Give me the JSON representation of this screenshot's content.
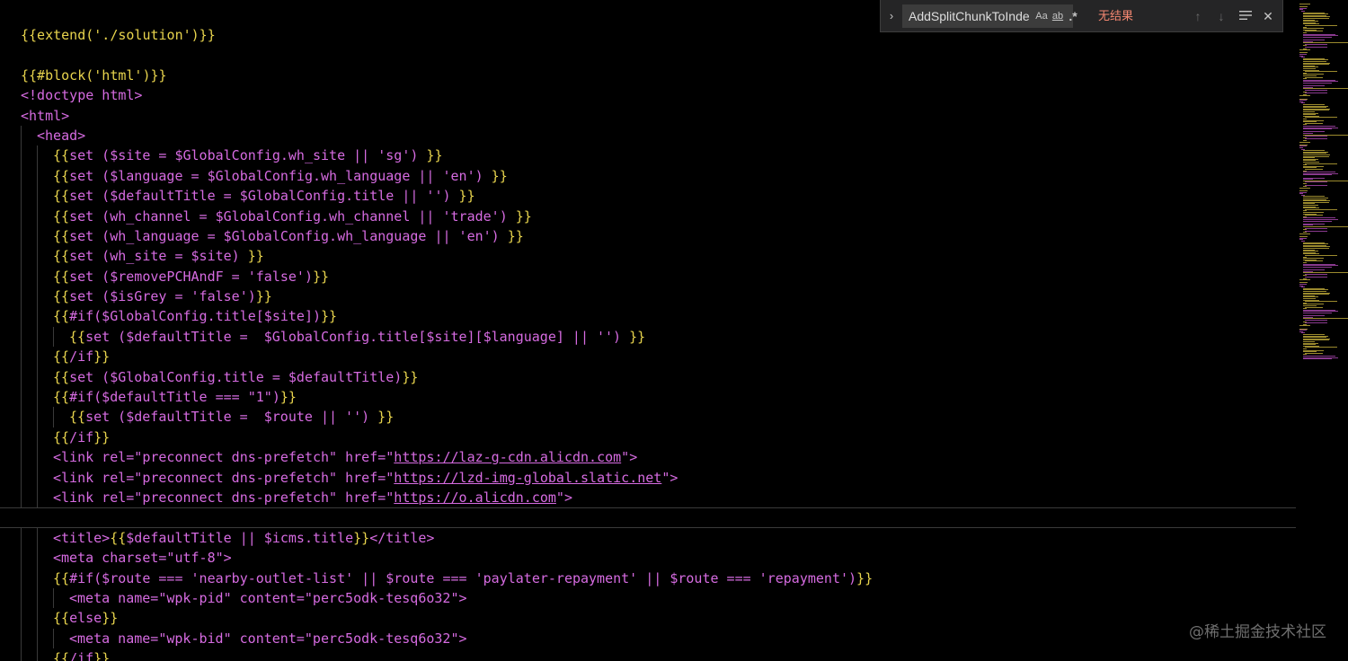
{
  "find_widget": {
    "query": "AddSplitChunkToInde",
    "match_case_label": "Aa",
    "whole_word_label": "ab",
    "regex_label": ".*",
    "result_text": "无结果",
    "toggle_icon": "chevron-right-icon",
    "prev_icon": "arrow-up-icon",
    "next_icon": "arrow-down-icon",
    "selection_icon": "find-in-selection-icon",
    "close_icon": "close-icon"
  },
  "colors": {
    "background": "#000000",
    "brace": "#e8d44d",
    "tag": "#d66be1",
    "text": "#d8d8d8",
    "no_results": "#f48771"
  },
  "watermark": "@稀土掘金技术社区",
  "code_lines": [
    {
      "indent": 0,
      "tokens": [
        [
          "b",
          "{{extend('./solution')}}"
        ]
      ]
    },
    {
      "indent": 0,
      "tokens": []
    },
    {
      "indent": 0,
      "tokens": [
        [
          "b",
          "{{#block('html')}}"
        ]
      ]
    },
    {
      "indent": 0,
      "tokens": [
        [
          "g",
          "<!doctype html>"
        ]
      ]
    },
    {
      "indent": 0,
      "tokens": [
        [
          "g",
          "<html>"
        ]
      ]
    },
    {
      "indent": 1,
      "tokens": [
        [
          "g",
          "<head>"
        ]
      ]
    },
    {
      "indent": 2,
      "tokens": [
        [
          "b",
          "{{"
        ],
        [
          "g",
          "set ($site = $GlobalConfig.wh_site || 'sg') "
        ],
        [
          "b",
          "}}"
        ]
      ]
    },
    {
      "indent": 2,
      "tokens": [
        [
          "b",
          "{{"
        ],
        [
          "g",
          "set ($language = $GlobalConfig.wh_language || 'en') "
        ],
        [
          "b",
          "}}"
        ]
      ]
    },
    {
      "indent": 2,
      "tokens": [
        [
          "b",
          "{{"
        ],
        [
          "g",
          "set ($defaultTitle = $GlobalConfig.title || '') "
        ],
        [
          "b",
          "}}"
        ]
      ]
    },
    {
      "indent": 2,
      "tokens": [
        [
          "b",
          "{{"
        ],
        [
          "g",
          "set (wh_channel = $GlobalConfig.wh_channel || 'trade') "
        ],
        [
          "b",
          "}}"
        ]
      ]
    },
    {
      "indent": 2,
      "tokens": [
        [
          "b",
          "{{"
        ],
        [
          "g",
          "set (wh_language = $GlobalConfig.wh_language || 'en') "
        ],
        [
          "b",
          "}}"
        ]
      ]
    },
    {
      "indent": 2,
      "tokens": [
        [
          "b",
          "{{"
        ],
        [
          "g",
          "set (wh_site = $site) "
        ],
        [
          "b",
          "}}"
        ]
      ]
    },
    {
      "indent": 2,
      "tokens": [
        [
          "b",
          "{{"
        ],
        [
          "g",
          "set ($removePCHAndF = 'false')"
        ],
        [
          "b",
          "}}"
        ]
      ]
    },
    {
      "indent": 2,
      "tokens": [
        [
          "b",
          "{{"
        ],
        [
          "g",
          "set ($isGrey = 'false')"
        ],
        [
          "b",
          "}}"
        ]
      ]
    },
    {
      "indent": 2,
      "tokens": [
        [
          "b",
          "{{"
        ],
        [
          "g",
          "#if($GlobalConfig.title[$site])"
        ],
        [
          "b",
          "}}"
        ]
      ]
    },
    {
      "indent": 3,
      "tokens": [
        [
          "b",
          "{{"
        ],
        [
          "g",
          "set ($defaultTitle =  $GlobalConfig.title[$site][$language] || '') "
        ],
        [
          "b",
          "}}"
        ]
      ]
    },
    {
      "indent": 2,
      "tokens": [
        [
          "b",
          "{{"
        ],
        [
          "g",
          "/if"
        ],
        [
          "b",
          "}}"
        ]
      ]
    },
    {
      "indent": 2,
      "tokens": [
        [
          "b",
          "{{"
        ],
        [
          "g",
          "set ($GlobalConfig.title = $defaultTitle)"
        ],
        [
          "b",
          "}}"
        ]
      ]
    },
    {
      "indent": 2,
      "tokens": [
        [
          "b",
          "{{"
        ],
        [
          "g",
          "#if($defaultTitle === \"1\")"
        ],
        [
          "b",
          "}}"
        ]
      ]
    },
    {
      "indent": 3,
      "tokens": [
        [
          "b",
          "{{"
        ],
        [
          "g",
          "set ($defaultTitle =  $route || '') "
        ],
        [
          "b",
          "}}"
        ]
      ]
    },
    {
      "indent": 2,
      "tokens": [
        [
          "b",
          "{{"
        ],
        [
          "g",
          "/if"
        ],
        [
          "b",
          "}}"
        ]
      ]
    },
    {
      "indent": 2,
      "tokens": [
        [
          "g",
          "<link rel=\"preconnect dns-prefetch\" href=\""
        ],
        [
          "u",
          "https://laz-g-cdn.alicdn.com"
        ],
        [
          "g",
          "\">"
        ]
      ]
    },
    {
      "indent": 2,
      "tokens": [
        [
          "g",
          "<link rel=\"preconnect dns-prefetch\" href=\""
        ],
        [
          "u",
          "https://lzd-img-global.slatic.net"
        ],
        [
          "g",
          "\">"
        ]
      ]
    },
    {
      "indent": 2,
      "tokens": [
        [
          "g",
          "<link rel=\"preconnect dns-prefetch\" href=\""
        ],
        [
          "u",
          "https://o.alicdn.com"
        ],
        [
          "g",
          "\">"
        ]
      ]
    },
    {
      "indent": 0,
      "tokens": [],
      "current": true
    },
    {
      "indent": 2,
      "tokens": [
        [
          "g",
          "<title>"
        ],
        [
          "b",
          "{{"
        ],
        [
          "g",
          "$defaultTitle || $icms.title"
        ],
        [
          "b",
          "}}"
        ],
        [
          "g",
          "</title>"
        ]
      ]
    },
    {
      "indent": 2,
      "tokens": [
        [
          "g",
          "<meta charset=\"utf-8\">"
        ]
      ]
    },
    {
      "indent": 2,
      "tokens": [
        [
          "b",
          "{{"
        ],
        [
          "g",
          "#if($route === 'nearby-outlet-list' || $route === 'paylater-repayment' || $route === 'repayment')"
        ],
        [
          "b",
          "}}"
        ]
      ]
    },
    {
      "indent": 3,
      "tokens": [
        [
          "g",
          "<meta name=\"wpk-pid\" content=\"perc5odk-tesq6o32\">"
        ]
      ]
    },
    {
      "indent": 2,
      "tokens": [
        [
          "b",
          "{{"
        ],
        [
          "g",
          "else"
        ],
        [
          "b",
          "}}"
        ]
      ]
    },
    {
      "indent": 3,
      "tokens": [
        [
          "g",
          "<meta name=\"wpk-bid\" content=\"perc5odk-tesq6o32\">"
        ]
      ]
    },
    {
      "indent": 2,
      "tokens": [
        [
          "b",
          "{{"
        ],
        [
          "g",
          "/if"
        ],
        [
          "b",
          "}}"
        ]
      ]
    }
  ]
}
